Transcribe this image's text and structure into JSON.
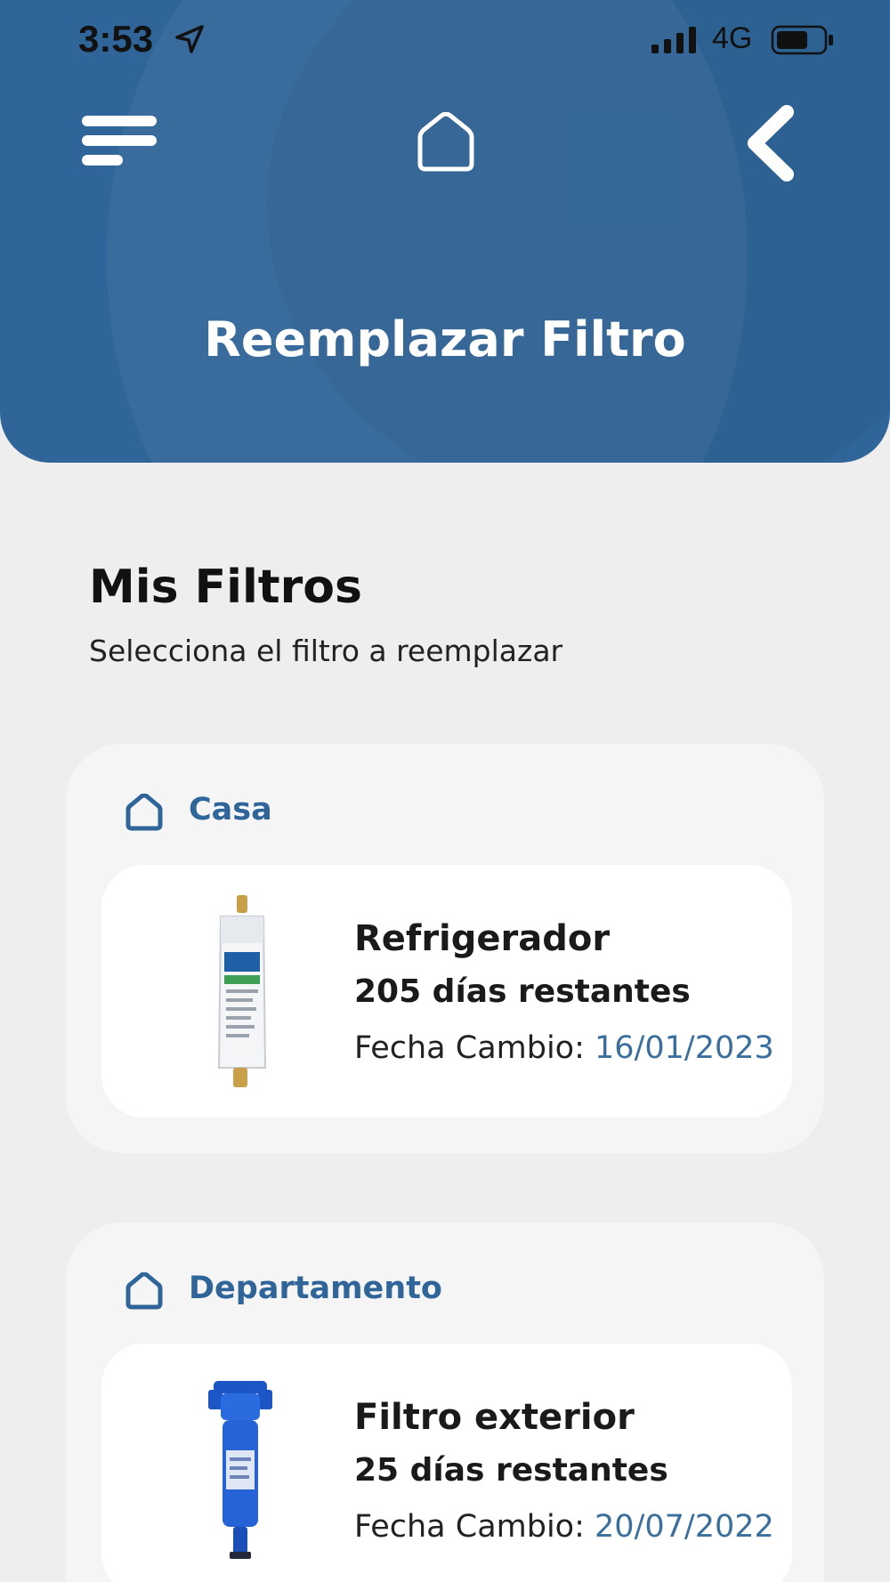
{
  "status_bar": {
    "time": "3:53",
    "network": "4G",
    "icons": [
      "location-arrow-icon",
      "signal-icon",
      "battery-icon"
    ]
  },
  "header": {
    "title": "Reemplazar Filtro",
    "icons": [
      "menu-icon",
      "home-icon",
      "back-icon"
    ],
    "background_color": "#2f6598"
  },
  "section": {
    "title": "Mis Filtros",
    "subtitle": "Selecciona el filtro a reemplazar"
  },
  "groups": [
    {
      "label": "Casa",
      "icon": "home-outline-icon",
      "filter": {
        "name": "Refrigerador",
        "days_remaining": "205 días restantes",
        "change_label": "Fecha Cambio:",
        "change_date": "16/01/2023",
        "image": "refrigerator-filter-cartridge"
      }
    },
    {
      "label": "Departamento",
      "icon": "home-outline-icon",
      "filter": {
        "name": "Filtro exterior",
        "days_remaining": "25 días restantes",
        "change_label": "Fecha Cambio:",
        "change_date": "20/07/2022",
        "image": "blue-exterior-filter-housing"
      }
    }
  ],
  "colors": {
    "accent": "#2f6598",
    "date_value": "#3a6f9e",
    "page_background": "#eeeeee"
  }
}
